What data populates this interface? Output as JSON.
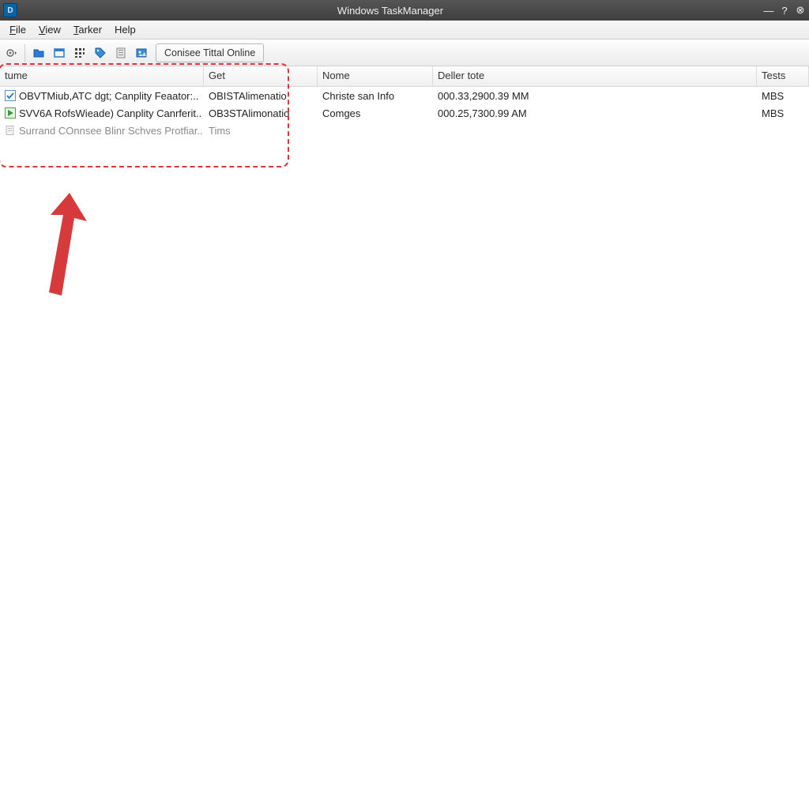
{
  "window": {
    "title": "Windows TaskManager",
    "app_icon_letter": "D"
  },
  "menu": {
    "file": "File",
    "view": "View",
    "tracker": "Tarker",
    "help": "Help"
  },
  "toolbar": {
    "tab_label": "Conisee Tittal Online"
  },
  "columns": {
    "tume": "tume",
    "get": "Get",
    "nome": "Nome",
    "deller": "Deller tote",
    "tests": "Tests"
  },
  "rows": [
    {
      "icon": "check",
      "tume": "OBVTMiub,ATC dgt; Canplity Feaator:..",
      "get": "OBISTAlimenatio",
      "nome": "Christe san Info",
      "deller": "000.33,2900.39 MM",
      "tests": "MBS"
    },
    {
      "icon": "play",
      "tume": "SVV6A RofsWieade) Canplity Canrferit..",
      "get": "OB3STAlimonatio",
      "nome": "Comges",
      "deller": "000.25,7300.99 AM",
      "tests": "MBS"
    },
    {
      "icon": "doc",
      "tume": "Surrand COnnsee Blinr Schves Protfiar..",
      "get": "Tims",
      "nome": "",
      "deller": "",
      "tests": ""
    }
  ]
}
